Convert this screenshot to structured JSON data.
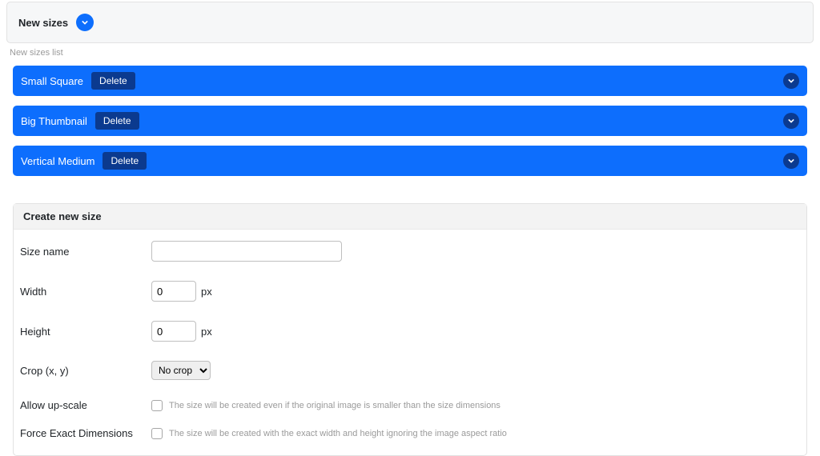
{
  "header": {
    "title": "New sizes"
  },
  "sublabel": "New sizes list",
  "sizes": [
    {
      "name": "Small Square",
      "delete_label": "Delete"
    },
    {
      "name": "Big Thumbnail",
      "delete_label": "Delete"
    },
    {
      "name": "Vertical Medium",
      "delete_label": "Delete"
    }
  ],
  "create": {
    "header": "Create new size",
    "size_name_label": "Size name",
    "size_name_value": "",
    "width_label": "Width",
    "width_value": "0",
    "width_unit": "px",
    "height_label": "Height",
    "height_value": "0",
    "height_unit": "px",
    "crop_label": "Crop (x, y)",
    "crop_selected": "No crop",
    "upscale_label": "Allow up-scale",
    "upscale_help": "The size will be created even if the original image is smaller than the size dimensions",
    "force_label": "Force Exact Dimensions",
    "force_help": "The size will be created with the exact width and height ignoring the image aspect ratio"
  }
}
